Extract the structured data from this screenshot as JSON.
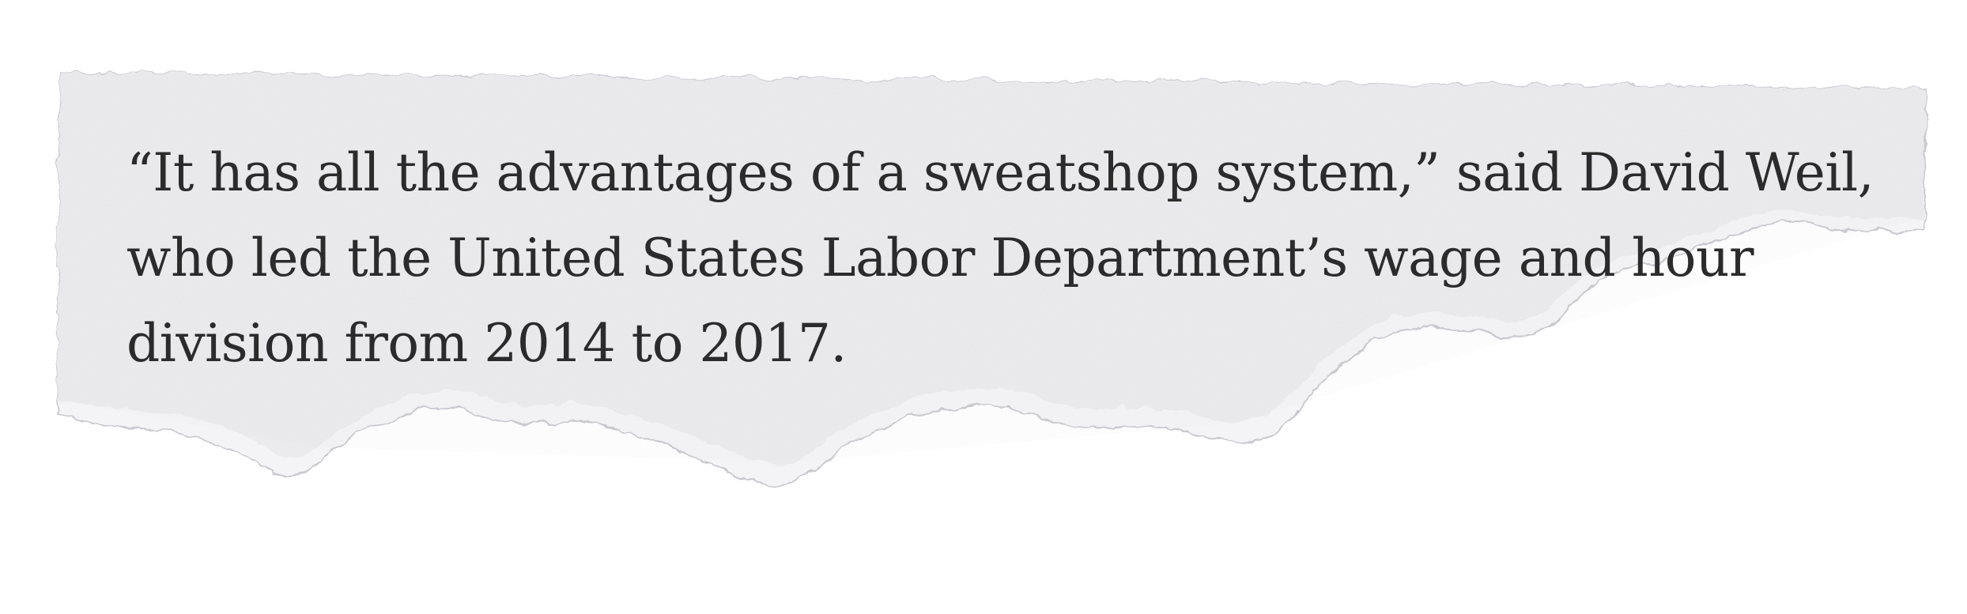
{
  "quote": {
    "lines": [
      "“It has all the advantages of a sweatshop system,” said David Weil,",
      "who led the United States Labor Department’s wage and hour",
      "division from 2014 to 2017."
    ]
  },
  "colors": {
    "paper": "#ebebee",
    "paper_edge": "#d9dade",
    "text": "#2b2b2b",
    "background": "#ffffff"
  }
}
